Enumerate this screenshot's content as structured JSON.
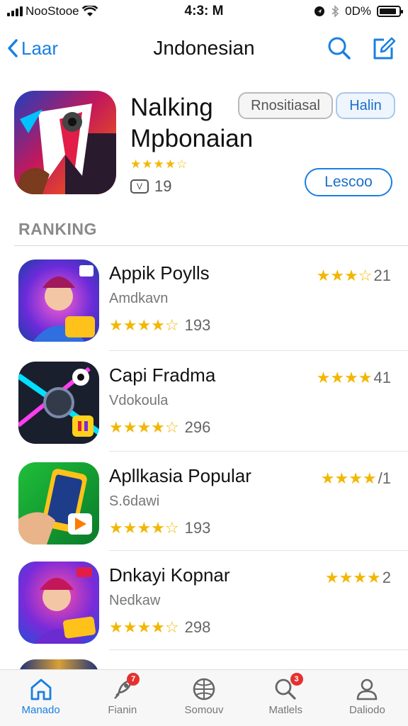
{
  "status_bar": {
    "carrier": "NooStooe",
    "time": "4:3: M",
    "battery": "0D%",
    "battery_level_percent": 90
  },
  "nav": {
    "back_label": "Laar",
    "title": "Jndonesian"
  },
  "featured": {
    "name_line1": "Nalking",
    "name_line2": "Mpbonaian",
    "stars": "★★★★☆",
    "age_rating": "V",
    "count": "19",
    "chip_primary": "Rnositiasal",
    "chip_secondary": "Halin",
    "get_button": "Lescoo"
  },
  "section": {
    "title": "RANKING"
  },
  "apps": [
    {
      "name": "Appik Poylls",
      "subtitle": "Amdkavn",
      "stars": "★★★★☆",
      "reviews": "193",
      "right_stars": "★★★☆",
      "right_value": "21"
    },
    {
      "name": "Capi Fradma",
      "subtitle": "Vdokoula",
      "stars": "★★★★☆",
      "reviews": "296",
      "right_stars": "★★★★",
      "right_value": "41"
    },
    {
      "name": "Apllkasia Popular",
      "subtitle": "S.6dawi",
      "stars": "★★★★☆",
      "reviews": "193",
      "right_stars": "★★★★",
      "right_value": "/1"
    },
    {
      "name": "Dnkayi Kopnar",
      "subtitle": "Nedkaw",
      "stars": "★★★★☆",
      "reviews": "298",
      "right_stars": "★★★★",
      "right_value": "2"
    }
  ],
  "tabs": [
    {
      "label": "Manado",
      "icon": "home-icon",
      "active": true
    },
    {
      "label": "Fianin",
      "icon": "rocket-icon",
      "badge": "7"
    },
    {
      "label": "Somouv",
      "icon": "globe-icon"
    },
    {
      "label": "Matlels",
      "icon": "search-icon",
      "badge": "3"
    },
    {
      "label": "Daliodo",
      "icon": "person-icon"
    }
  ],
  "colors": {
    "accent": "#1a7fe0",
    "star": "#f2b705",
    "badge": "#e53030"
  }
}
